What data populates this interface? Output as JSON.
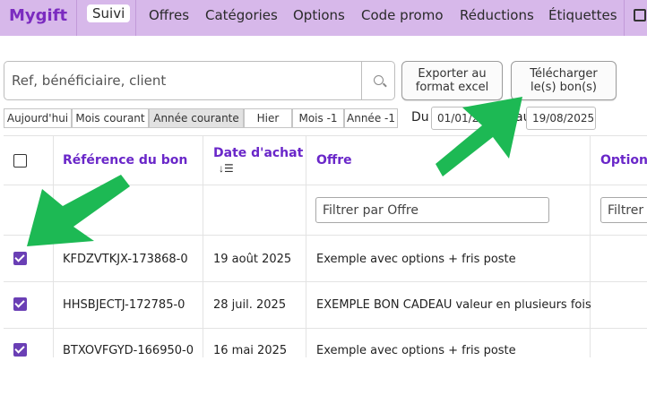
{
  "nav": {
    "brand": "Mygift",
    "items": [
      "Suivi",
      "Offres",
      "Catégories",
      "Options",
      "Code promo",
      "Réductions",
      "Étiquettes"
    ]
  },
  "search": {
    "placeholder": "Ref, bénéficiaire, client",
    "value": "",
    "icon": "search-icon"
  },
  "buttons": {
    "export_line1": "Exporter au",
    "export_line2": "format excel",
    "download_line1": "Télécharger",
    "download_line2": "le(s) bon(s)"
  },
  "periods": [
    "Aujourd'hui",
    "Mois courant",
    "Année courante",
    "Hier",
    "Mois -1",
    "Année -1"
  ],
  "period_active": "Année courante",
  "date_range": {
    "du_label": "Du",
    "from": "01/01/2025",
    "au_label": "au",
    "to": "19/08/2025"
  },
  "table": {
    "headers": {
      "reference": "Référence du bon",
      "date_line1": "Date d'achat",
      "offer": "Offre",
      "options": "Options"
    },
    "filter_offer_placeholder": "Filtrer par Offre",
    "filter_options_placeholder": "Filtrer par Options",
    "rows": [
      {
        "reference": "KFDZVTKJX-173868-0",
        "date": "19 août 2025",
        "offer": "Exemple avec options + fris poste",
        "checked": true
      },
      {
        "reference": "HHSBJECTJ-172785-0",
        "date": "28 juil. 2025",
        "offer": "EXEMPLE BON CADEAU valeur en plusieurs fois",
        "checked": true
      },
      {
        "reference": "BTXOVFGYD-166950-0",
        "date": "16 mai 2025",
        "offer": "Exemple avec options + fris poste",
        "checked": true
      }
    ]
  },
  "colors": {
    "nav_bg": "#d7b8ea",
    "brand": "#7b2bc0",
    "header_text": "#6a27c9",
    "checkbox": "#6a3fb5",
    "arrow": "#1db954"
  }
}
